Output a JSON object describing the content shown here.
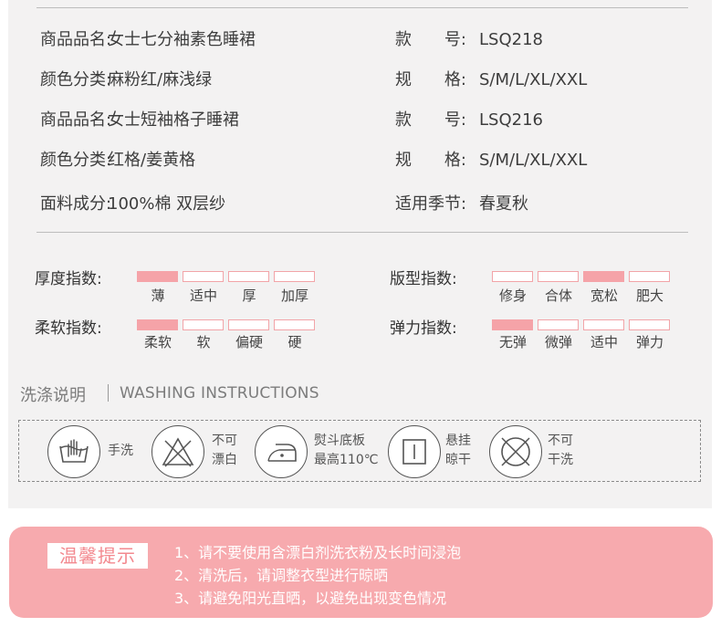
{
  "specs": {
    "row1": {
      "left_key": "商品品名:",
      "left_val": "女士七分袖素色睡裙",
      "right_key_a": "款",
      "right_key_b": "号:",
      "right_val": "LSQ218"
    },
    "row2": {
      "left_key": "颜色分类:",
      "left_val": "麻粉红/麻浅绿",
      "right_key_a": "规",
      "right_key_b": "格:",
      "right_val": "S/M/L/XL/XXL"
    },
    "row3": {
      "left_key": "商品品名:",
      "left_val": "女士短袖格子睡裙",
      "right_key_a": "款",
      "right_key_b": "号:",
      "right_val": "LSQ216"
    },
    "row4": {
      "left_key": "颜色分类:",
      "left_val": "红格/姜黄格",
      "right_key_a": "规",
      "right_key_b": "格:",
      "right_val": "S/M/L/XL/XXL"
    },
    "row5": {
      "left_key": "面料成分:",
      "left_val": "100%棉 双层纱",
      "right_key": "适用季节:",
      "right_val": "春夏秋"
    }
  },
  "indices": [
    {
      "label": "厚度指数:",
      "options": [
        "薄",
        "适中",
        "厚",
        "加厚"
      ],
      "selected": 0
    },
    {
      "label": "版型指数:",
      "options": [
        "修身",
        "合体",
        "宽松",
        "肥大"
      ],
      "selected": 2
    },
    {
      "label": "柔软指数:",
      "options": [
        "柔软",
        "软",
        "偏硬",
        "硬"
      ],
      "selected": 0
    },
    {
      "label": "弹力指数:",
      "options": [
        "无弹",
        "微弹",
        "适中",
        "弹力"
      ],
      "selected": 0
    }
  ],
  "washing": {
    "title": "洗涤说明",
    "title_en": "WASHING INSTRUCTIONS",
    "items": [
      {
        "icon": "hand-wash-icon",
        "text1": "手洗",
        "text2": ""
      },
      {
        "icon": "no-bleach-icon",
        "text1": "不可",
        "text2": "漂白"
      },
      {
        "icon": "iron-icon",
        "text1": "熨斗底板",
        "text2": "最高110℃"
      },
      {
        "icon": "hang-dry-icon",
        "text1": "悬挂",
        "text2": "晾干"
      },
      {
        "icon": "no-dry-clean-icon",
        "text1": "不可",
        "text2": "干洗"
      }
    ]
  },
  "tips": {
    "title": "温馨提示",
    "lines": [
      "1、请不要使用含漂白剂洗衣粉及长时间浸泡",
      "2、清洗后，请调整衣型进行晾晒",
      "3、请避免阳光直晒，以避免出现变色情况"
    ]
  },
  "colors": {
    "accent_pink": "#f5a3a8",
    "panel_bg": "#f3f2f2",
    "tips_bg": "#f7aaae",
    "tips_title_text": "#f3898f"
  }
}
